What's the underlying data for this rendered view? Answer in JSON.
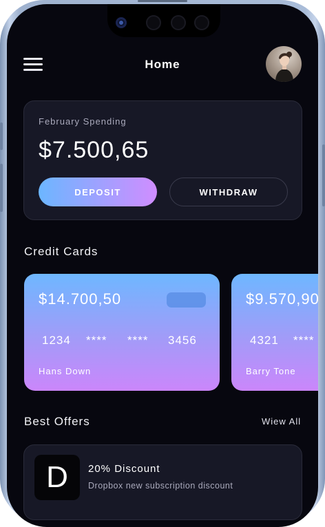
{
  "header": {
    "title": "Home"
  },
  "balance": {
    "label": "February Spending",
    "amount": "$7.500,65",
    "deposit_label": "DEPOSIT",
    "withdraw_label": "WITHDRAW"
  },
  "credit_cards": {
    "title": "Credit Cards",
    "cards": [
      {
        "balance": "$14.700,50",
        "number_groups": [
          "1234",
          "****",
          "****",
          "3456"
        ],
        "holder": "Hans Down"
      },
      {
        "balance": "$9.570,90",
        "number_groups": [
          "4321",
          "****"
        ],
        "holder": "Barry Tone"
      }
    ]
  },
  "offers": {
    "title": "Best Offers",
    "view_all_label": "Wiew All",
    "items": [
      {
        "logo_letter": "D",
        "title": "20% Discount",
        "description": "Dropbox new subscription discount"
      }
    ]
  },
  "colors": {
    "background": "#07070f",
    "card_surface": "#171826",
    "accent_start": "#6cb6ff",
    "accent_end": "#d08dff"
  },
  "icons": {
    "menu": "hamburger-menu-icon"
  }
}
